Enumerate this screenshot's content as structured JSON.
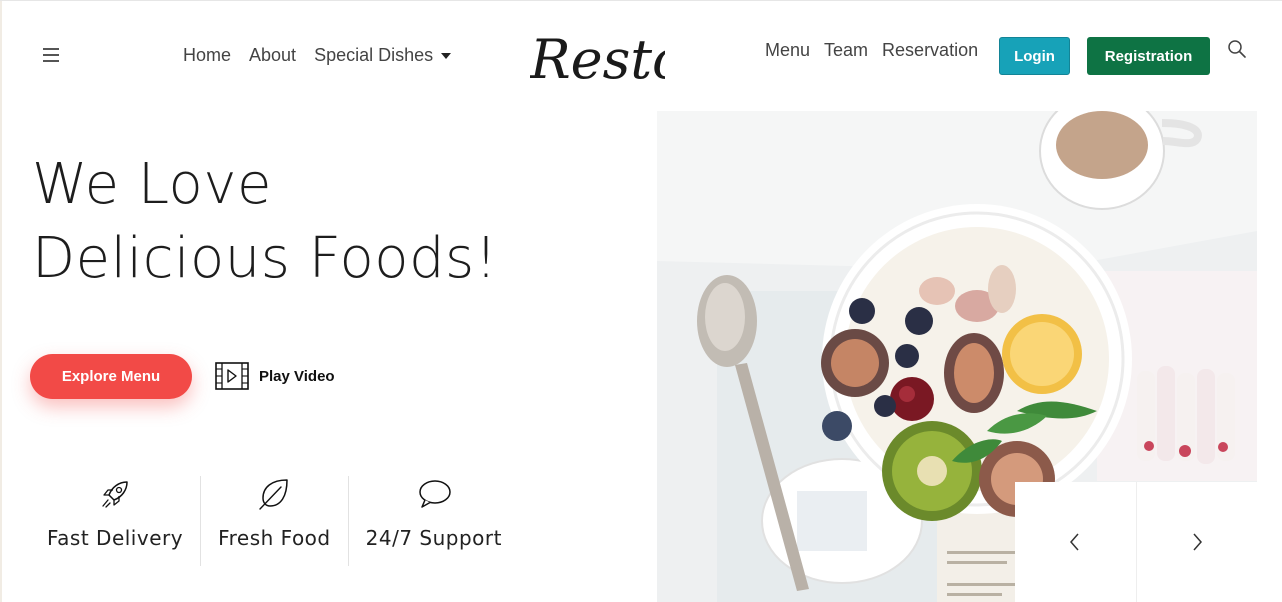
{
  "header": {
    "logo_text": "Resto",
    "nav_left": [
      "Home",
      "About",
      "Special Dishes"
    ],
    "nav_right": [
      "Menu",
      "Team",
      "Reservation"
    ],
    "login_label": "Login",
    "registration_label": "Registration"
  },
  "hero": {
    "title_line1": "We Love",
    "title_line2": "Delicious Foods!",
    "explore_label": "Explore Menu",
    "play_label": "Play Video"
  },
  "features": [
    {
      "label": "Fast Delivery",
      "icon": "rocket-icon"
    },
    {
      "label": "Fresh Food",
      "icon": "leaf-icon"
    },
    {
      "label": "24/7 Support",
      "icon": "chat-bubble-icon"
    }
  ],
  "colors": {
    "accent_red": "#f24a47",
    "login_teal": "#17a2b8",
    "registration_green": "#0e7344"
  }
}
